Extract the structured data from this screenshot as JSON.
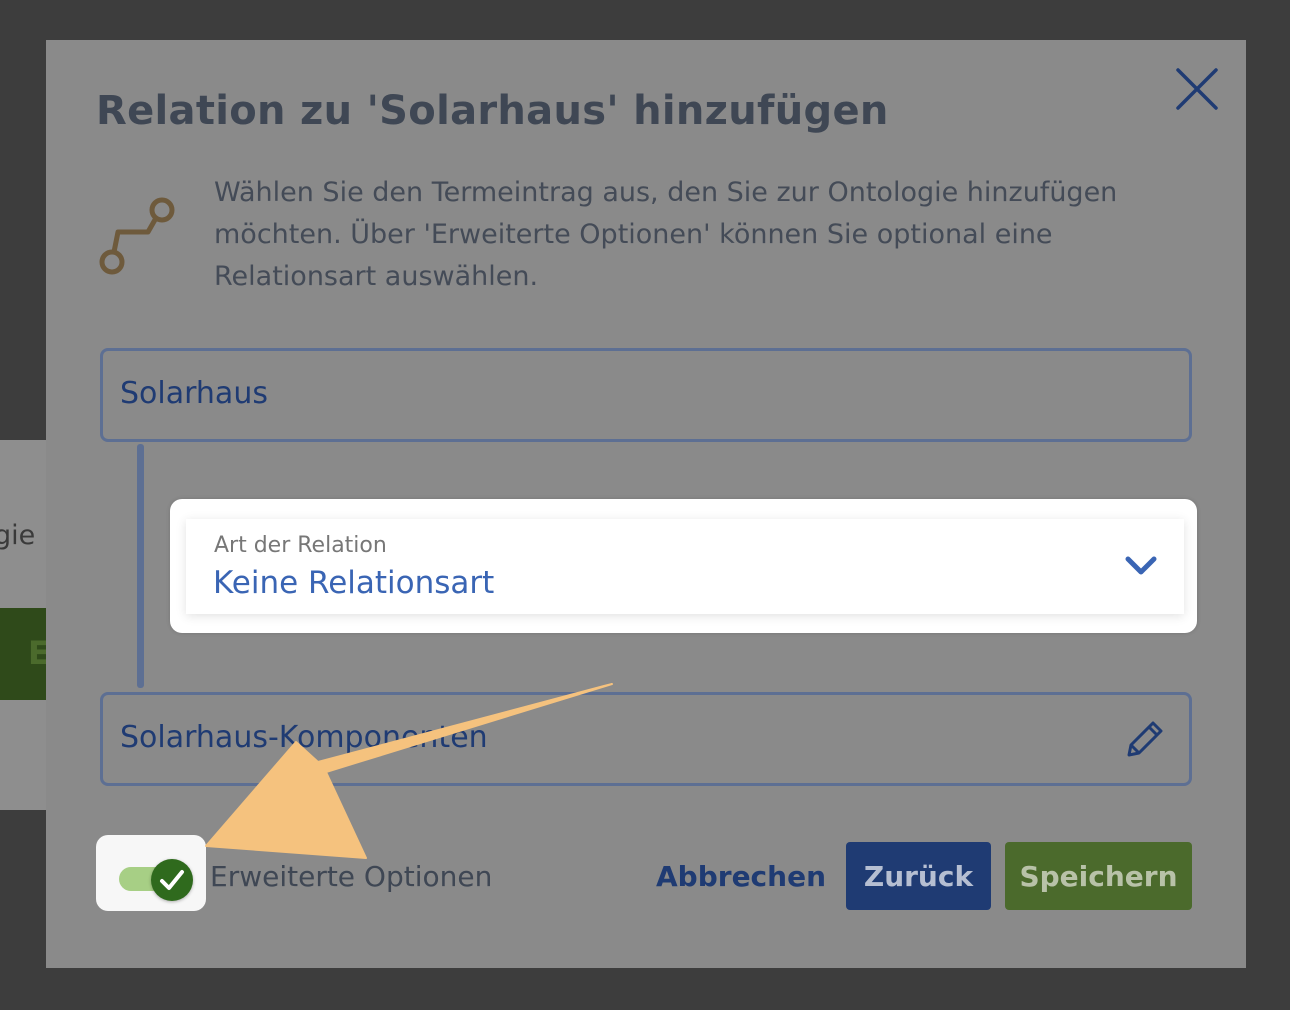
{
  "background": {
    "partial_text": "gie",
    "partial_button_letter": "E"
  },
  "dialog": {
    "title": "Relation zu 'Solarhaus' hinzufügen",
    "intro_text": "Wählen Sie den Termeintrag aus, den Sie zur Ontologie hinzufügen möchten. Über 'Erweiterte Optionen' können Sie optional eine Relationsart auswählen.",
    "source_term": "Solarhaus",
    "relation_select": {
      "label": "Art der Relation",
      "value": "Keine Relationsart"
    },
    "target_term": "Solarhaus-Komponenten",
    "advanced_options": {
      "label": "Erweiterte Optionen",
      "enabled": true
    },
    "buttons": {
      "cancel": "Abbrechen",
      "back": "Zurück",
      "save": "Speichern"
    }
  },
  "colors": {
    "overlay": "#8a8a8a",
    "primary_blue": "#1f3b73",
    "link_blue": "#3a65b4",
    "save_green": "#4b6a2c",
    "toggle_green": "#2f6a1d",
    "annotation_arrow": "#f5c27e"
  },
  "icons": {
    "close": "close-icon",
    "relation": "relation-path-icon",
    "chevron": "chevron-down-icon",
    "edit": "pencil-icon",
    "check": "check-icon"
  }
}
